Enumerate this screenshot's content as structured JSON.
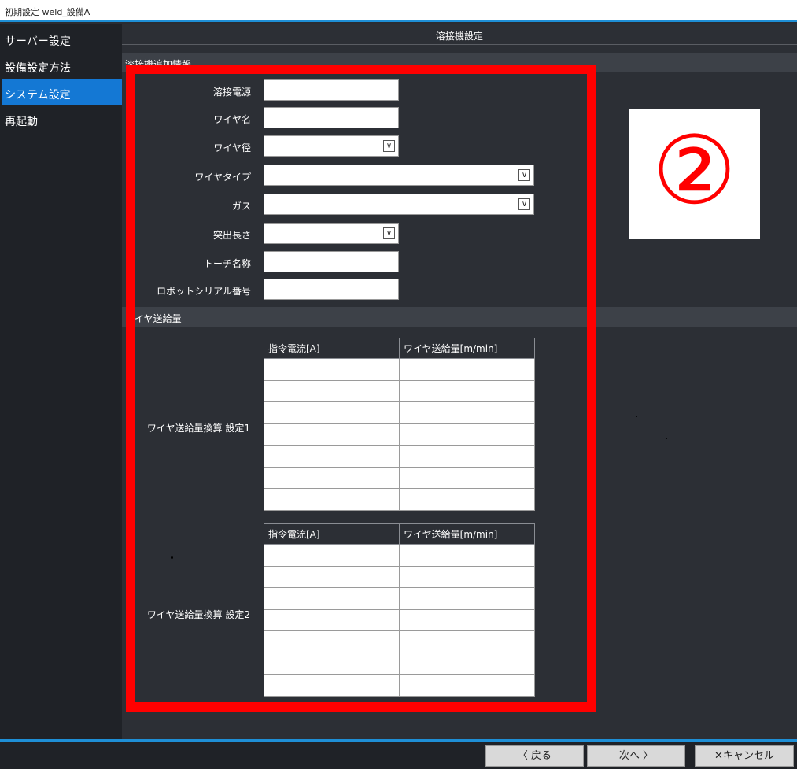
{
  "window": {
    "title": "初期設定 weld_設備A"
  },
  "sidebar": {
    "items": [
      {
        "label": "サーバー設定"
      },
      {
        "label": "設備設定方法"
      },
      {
        "label": "システム設定",
        "active": true
      },
      {
        "label": "再起動"
      }
    ]
  },
  "main": {
    "title": "溶接機設定",
    "section1": "溶接機追加情報",
    "section2": "ワイヤ送給量",
    "fields": {
      "power_source": {
        "label": "溶接電源",
        "value": ""
      },
      "wire_name": {
        "label": "ワイヤ名",
        "value": ""
      },
      "wire_diameter": {
        "label": "ワイヤ径",
        "value": ""
      },
      "wire_type": {
        "label": "ワイヤタイプ",
        "value": ""
      },
      "gas": {
        "label": "ガス",
        "value": ""
      },
      "stickout": {
        "label": "突出長さ",
        "value": ""
      },
      "torch_name": {
        "label": "トーチ名称",
        "value": ""
      },
      "robot_serial": {
        "label": "ロボットシリアル番号",
        "value": ""
      }
    },
    "table1": {
      "label": "ワイヤ送給量換算 設定1",
      "headers": [
        "指令電流[A]",
        "ワイヤ送給量[m/min]"
      ]
    },
    "table2": {
      "label": "ワイヤ送給量換算 設定2",
      "headers": [
        "指令電流[A]",
        "ワイヤ送給量[m/min]"
      ]
    }
  },
  "annotation": {
    "badge": "②",
    "frame_color": "#ff0000"
  },
  "footer": {
    "back": "〈 戻る",
    "next": "次へ 〉",
    "cancel": "✕キャンセル"
  },
  "colors": {
    "accent": "#1478d4",
    "sidebar_bg": "#1f2227",
    "main_bg": "#2c2f35"
  }
}
